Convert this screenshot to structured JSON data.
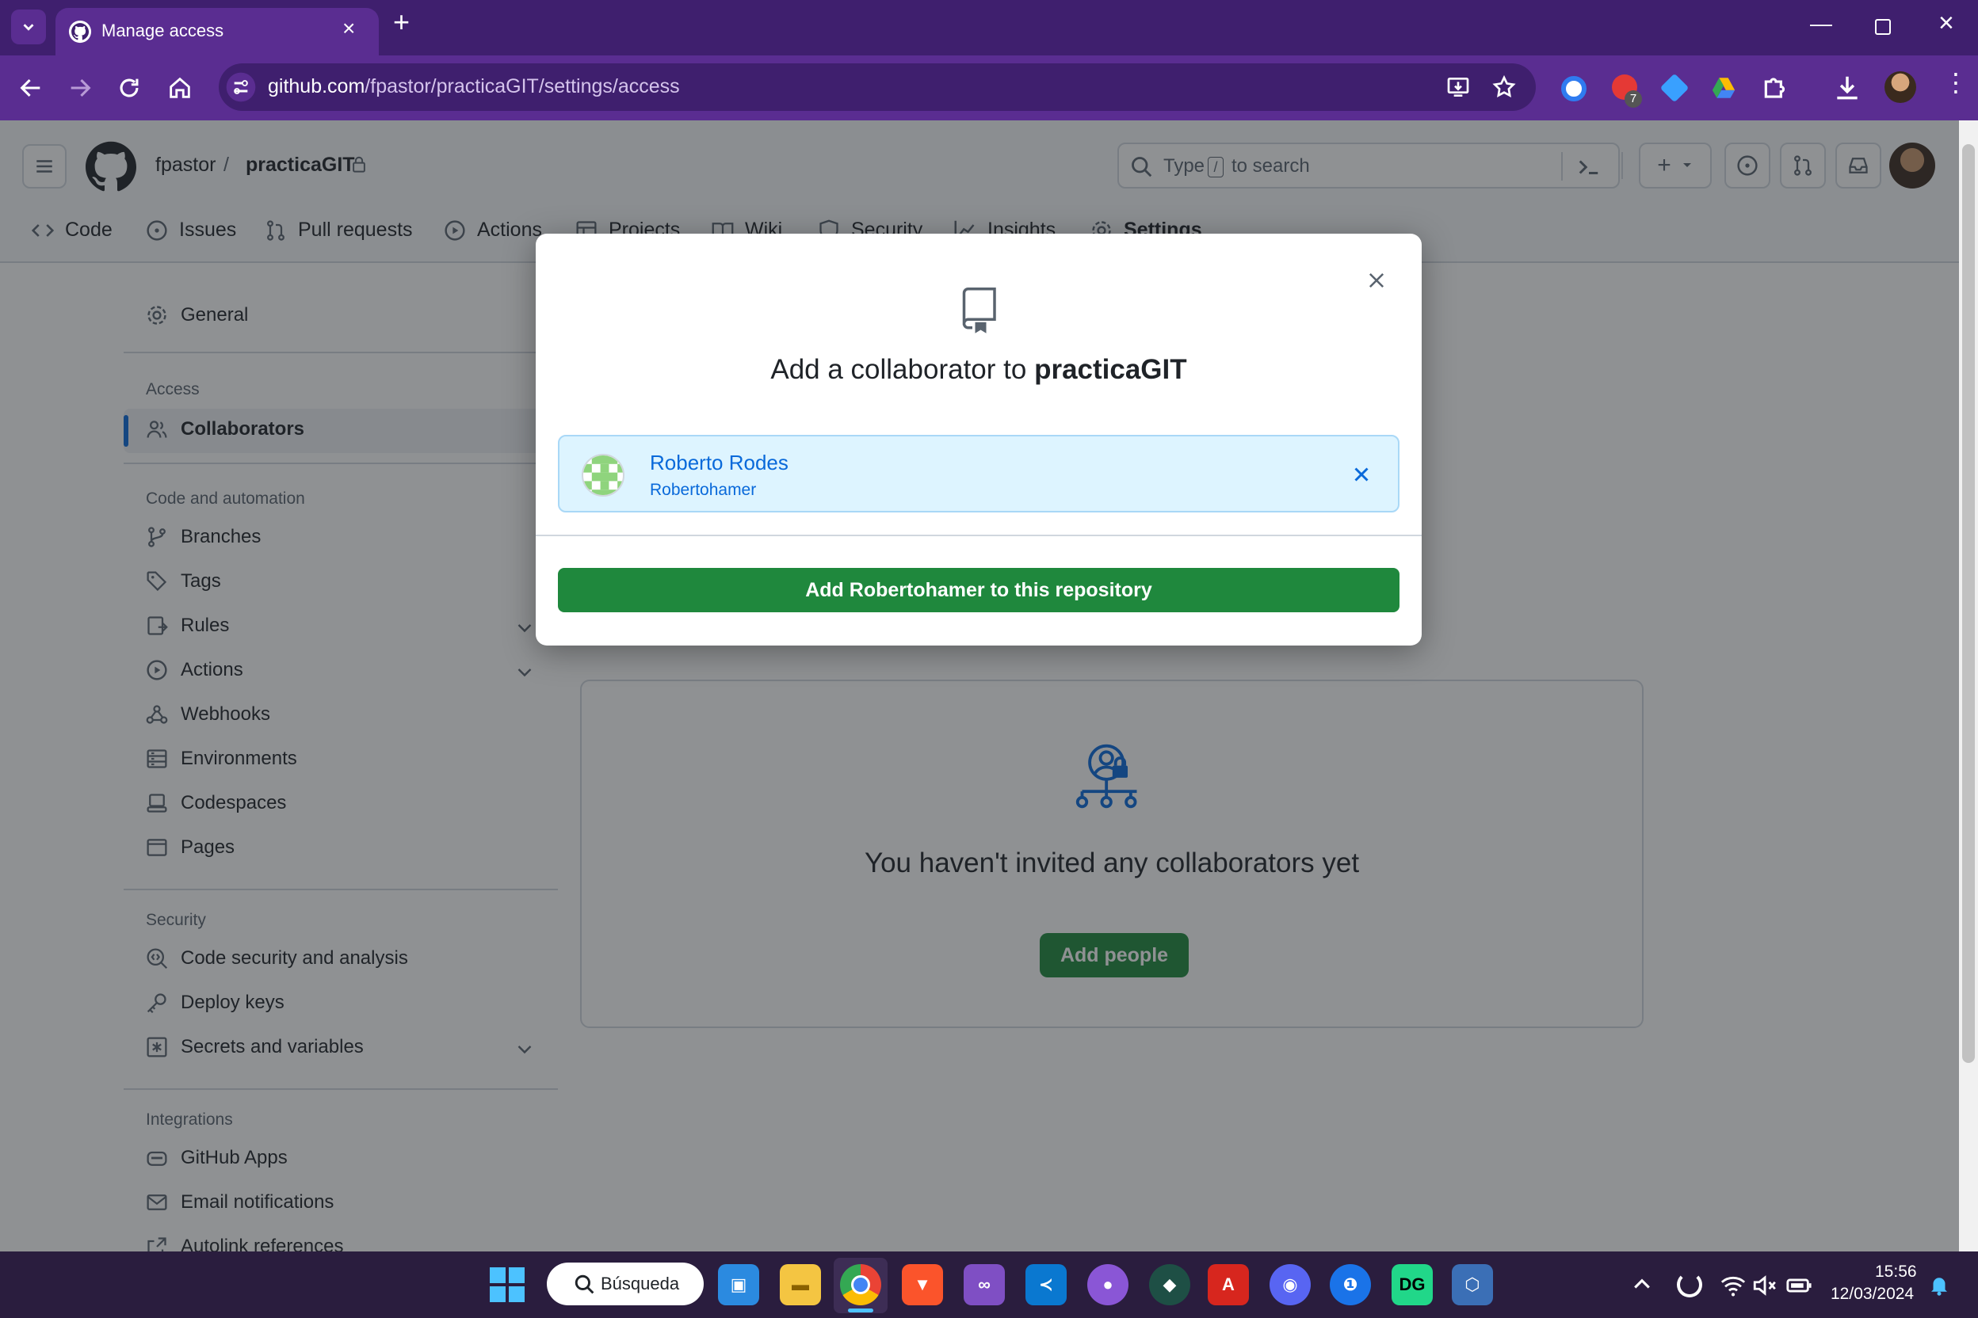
{
  "browser": {
    "tab_title": "Manage access",
    "url_domain": "github.com",
    "url_path": "/fpastor/practicaGIT/settings/access",
    "ext_badge": "7"
  },
  "github": {
    "owner": "fpastor",
    "separator": "/",
    "repo": "practicaGIT",
    "search_placeholder_pre": "Type",
    "search_slash": "/",
    "search_placeholder_post": "to search",
    "tabs": [
      "Code",
      "Issues",
      "Pull requests",
      "Actions",
      "Projects",
      "Wiki",
      "Security",
      "Insights",
      "Settings"
    ]
  },
  "sidebar": {
    "general": "General",
    "access_heading": "Access",
    "collaborators": "Collaborators",
    "code_heading": "Code and automation",
    "code_items": [
      "Branches",
      "Tags",
      "Rules",
      "Actions",
      "Webhooks",
      "Environments",
      "Codespaces",
      "Pages"
    ],
    "security_heading": "Security",
    "security_items": [
      "Code security and analysis",
      "Deploy keys",
      "Secrets and variables"
    ],
    "integrations_heading": "Integrations",
    "integration_items": [
      "GitHub Apps",
      "Email notifications",
      "Autolink references"
    ]
  },
  "main": {
    "empty_title": "You haven't invited any collaborators yet",
    "add_people": "Add people"
  },
  "dialog": {
    "title_pre": "Add a collaborator to",
    "title_repo": "practicaGIT",
    "user_name": "Roberto Rodes",
    "user_login": "Robertohamer",
    "add_button": "Add Robertohamer to this repository"
  },
  "taskbar": {
    "search": "Búsqueda",
    "time": "15:56",
    "date": "12/03/2024"
  },
  "colors": {
    "chrome_dark": "#3f1f6e",
    "chrome_light": "#5a2d91",
    "github_green": "#1f883d",
    "link_blue": "#0969da",
    "selected_bg": "#ddf4ff"
  }
}
